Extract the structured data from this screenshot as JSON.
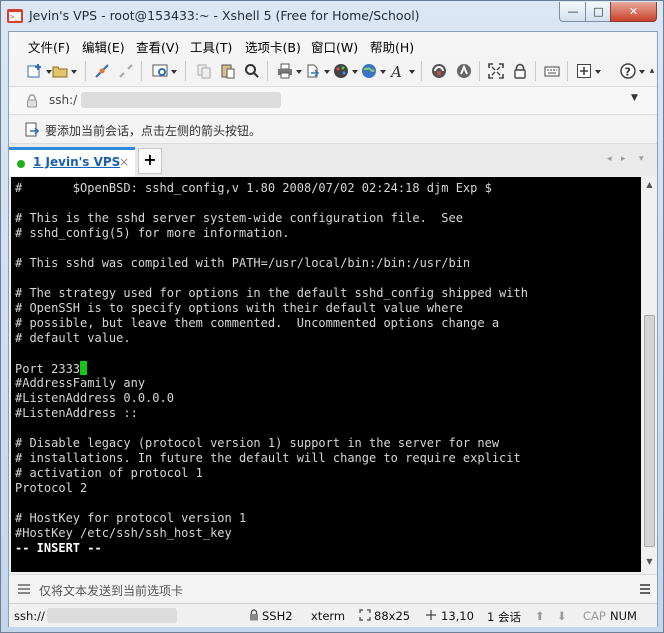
{
  "window": {
    "title": "Jevin's VPS - root@153433:~ - Xshell 5 (Free for Home/School)",
    "controls": {
      "minimize": "—",
      "maximize": "□",
      "close": "✕"
    }
  },
  "menu": [
    "文件(F)",
    "编辑(E)",
    "查看(V)",
    "工具(T)",
    "选项卡(B)",
    "窗口(W)",
    "帮助(H)"
  ],
  "toolbar_icons": [
    "new-session-icon",
    "open-folder-icon",
    "connect-icon",
    "disconnect-icon",
    "properties-icon",
    "copy-icon",
    "paste-icon",
    "find-icon",
    "print-icon",
    "transfer-icon",
    "color-scheme-icon",
    "globe-icon",
    "font-icon",
    "xftp-icon",
    "xmanager-icon",
    "fullscreen-icon",
    "lock-icon",
    "keyboard-icon",
    "add-icon",
    "help-icon"
  ],
  "address": {
    "value": "ssh:/"
  },
  "hint": {
    "text": "要添加当前会话，点击左侧的箭头按钮。"
  },
  "tabs": [
    {
      "label": "1 Jevin's VPS",
      "close": "×"
    }
  ],
  "tab_add": "+",
  "terminal": {
    "lines": [
      "#       $OpenBSD: sshd_config,v 1.80 2008/07/02 02:24:18 djm Exp $",
      "",
      "# This is the sshd server system-wide configuration file.  See",
      "# sshd_config(5) for more information.",
      "",
      "# This sshd was compiled with PATH=/usr/local/bin:/bin:/usr/bin",
      "",
      "# The strategy used for options in the default sshd_config shipped with",
      "# OpenSSH is to specify options with their default value where",
      "# possible, but leave them commented.  Uncommented options change a",
      "# default value.",
      "",
      "Port 2333",
      "#AddressFamily any",
      "#ListenAddress 0.0.0.0",
      "#ListenAddress ::",
      "",
      "# Disable legacy (protocol version 1) support in the server for new",
      "# installations. In future the default will change to require explicit",
      "# activation of protocol 1",
      "Protocol 2",
      "",
      "# HostKey for protocol version 1",
      "#HostKey /etc/ssh/ssh_host_key"
    ],
    "mode_line": "-- INSERT --",
    "cursor_line": 12
  },
  "sendbar": {
    "placeholder": "仅将文本发送到当前选项卡"
  },
  "status": {
    "address": "ssh://",
    "protocol": "SSH2",
    "term": "xterm",
    "size": "88x25",
    "position": "13,10",
    "sessions": "1 会话",
    "caps": "CAP",
    "num": "NUM"
  },
  "colors": {
    "terminal_bg": "#000000",
    "terminal_fg": "#d6d6d6",
    "cursor": "#18c418",
    "tab_accent": "#2a8adf"
  }
}
